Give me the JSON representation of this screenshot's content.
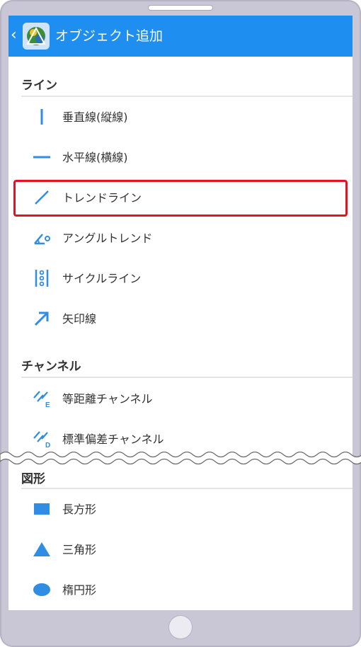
{
  "appbar": {
    "title": "オブジェクト追加",
    "back_icon": "chevron-left-icon",
    "logo_icon": "metatrader-logo-icon"
  },
  "sections": [
    {
      "title": "ライン",
      "items": [
        {
          "label": "垂直線(縦線)",
          "icon": "vertical-line-icon"
        },
        {
          "label": "水平線(横線)",
          "icon": "horizontal-line-icon"
        },
        {
          "label": "トレンドライン",
          "icon": "trendline-icon"
        },
        {
          "label": "アングルトレンド",
          "icon": "angle-trend-icon"
        },
        {
          "label": "サイクルライン",
          "icon": "cycle-lines-icon"
        },
        {
          "label": "矢印線",
          "icon": "arrow-line-icon"
        }
      ]
    },
    {
      "title": "チャンネル",
      "items": [
        {
          "label": "等距離チャンネル",
          "icon": "equidistant-channel-icon"
        },
        {
          "label": "標準偏差チャンネル",
          "icon": "stddev-channel-icon"
        }
      ]
    },
    {
      "title": "図形",
      "items": [
        {
          "label": "長方形",
          "icon": "rectangle-icon"
        },
        {
          "label": "三角形",
          "icon": "triangle-icon"
        },
        {
          "label": "楕円形",
          "icon": "ellipse-icon"
        }
      ]
    }
  ],
  "colors": {
    "accent": "#1e8ef0",
    "icon": "#2f8de4",
    "highlight": "#e1141f",
    "text": "#333333"
  }
}
